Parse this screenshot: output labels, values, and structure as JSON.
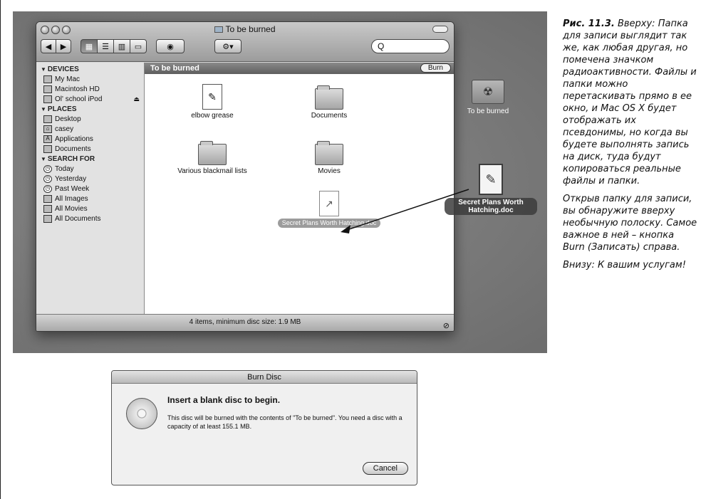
{
  "finder": {
    "title": "To be burned",
    "search_placeholder": "Q",
    "burn_bar_title": "To be burned",
    "burn_button": "Burn",
    "status": "4 items, minimum disc size: 1.9 MB",
    "sidebar": {
      "devices_header": "DEVICES",
      "devices": [
        "My Mac",
        "Macintosh HD",
        "Ol' school iPod"
      ],
      "places_header": "PLACES",
      "places": [
        "Desktop",
        "casey",
        "Applications",
        "Documents"
      ],
      "search_header": "SEARCH FOR",
      "searches": [
        "Today",
        "Yesterday",
        "Past Week",
        "All Images",
        "All Movies",
        "All Documents"
      ]
    },
    "items": [
      "elbow grease",
      "Documents",
      "Various blackmail lists",
      "Movies"
    ],
    "dragged_item_label": "Secret Plans Worth Hatching.doc"
  },
  "desktop": {
    "burn_folder_label": "To be burned",
    "doc_label": "Secret Plans Worth Hatching.doc"
  },
  "dialog": {
    "title": "Burn Disc",
    "heading": "Insert a blank disc to begin.",
    "body": "This disc will be burned with the contents of \"To be burned\". You need a disc with a capacity of at least 155.1 MB.",
    "cancel": "Cancel"
  },
  "caption": {
    "fig_label": "Рис. 11.3.",
    "para1": "Вверху: Папка для записи выглядит так же, как любая другая, но помечена значком радиоактивности. Файлы и папки можно перетаскивать прямо в ее окно, и Mac OS X будет отображать их псевдонимы, но когда вы будете выполнять запись на диск, туда будут копироваться реальные файлы и папки.",
    "para2": "Открыв папку для записи, вы обнаружите вверху необычную полоску. Самое важное в ней – кнопка Burn (Записать) справа.",
    "para3": "Внизу: К вашим услугам!"
  }
}
